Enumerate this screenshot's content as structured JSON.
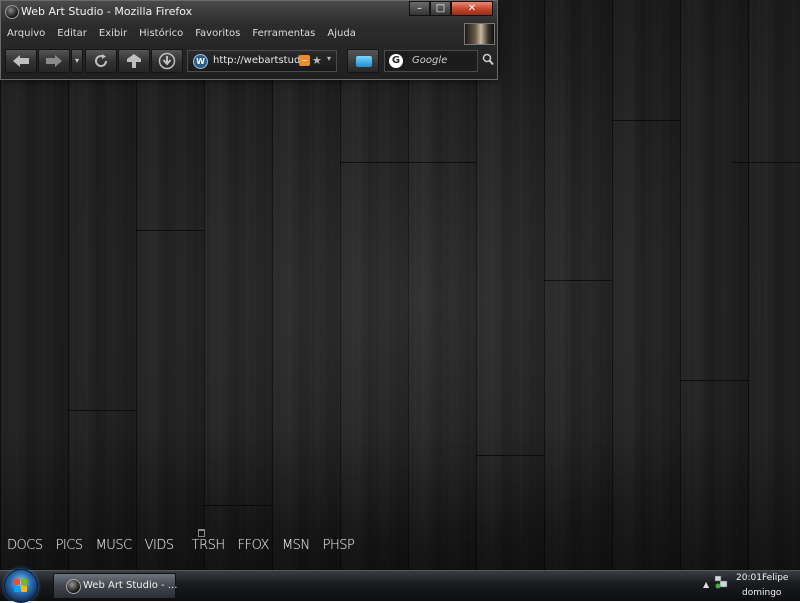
{
  "browser": {
    "window_title": "Web Art Studio - Mozilla Firefox",
    "controls": {
      "minimize": "–",
      "maximize": "□",
      "close": "✕"
    },
    "menu": [
      "Arquivo",
      "Editar",
      "Exibir",
      "Histórico",
      "Favoritos",
      "Ferramentas",
      "Ajuda"
    ],
    "url": "http://webartstudio",
    "search_placeholder": "Google",
    "icons": {
      "back": "arrow-left-icon",
      "forward": "arrow-right-icon",
      "reload": "reload-icon",
      "home": "home-icon",
      "download": "download-icon",
      "rss": "rss-icon",
      "star": "star-icon",
      "search": "magnifier-icon"
    }
  },
  "dock": {
    "items": [
      "DOCS",
      "PICS",
      "MUSC",
      "VIDS",
      "TRSH",
      "FFOX",
      "MSN",
      "PHSP"
    ]
  },
  "taskbar": {
    "task_label": "Web Art Studio - ...",
    "clock_time": "20:01",
    "user": "Felipe",
    "day": "domingo"
  },
  "colors": {
    "wallpaper": "#1d1d1d",
    "taskbar": "#1a1c20",
    "close_button": "#c44a2f",
    "rss": "#f08a22",
    "bookmark_icon": "#1a8fcf"
  }
}
